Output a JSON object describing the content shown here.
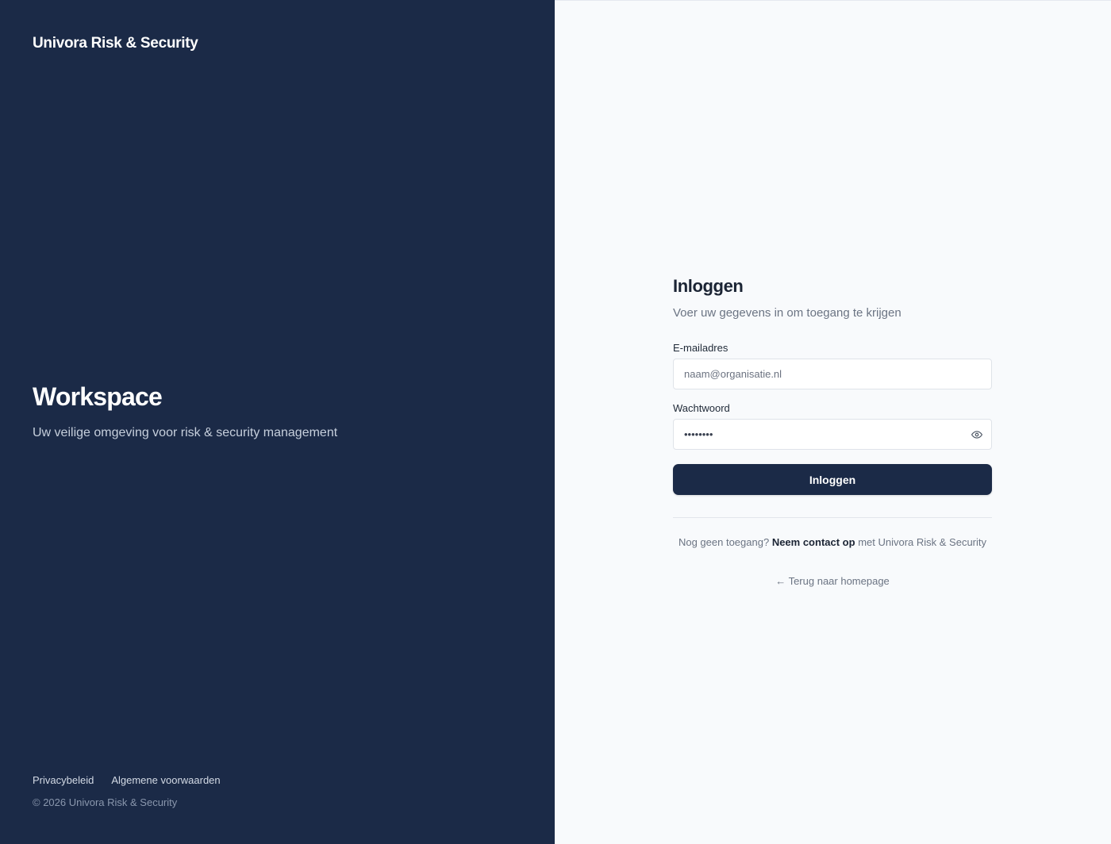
{
  "left": {
    "brand": "Univora Risk & Security",
    "hero_title": "Workspace",
    "hero_subtitle": "Uw veilige omgeving voor risk & security management",
    "footer_links": [
      "Privacybeleid",
      "Algemene voorwaarden"
    ],
    "copyright": "© 2026 Univora Risk & Security"
  },
  "form": {
    "title": "Inloggen",
    "subtitle": "Voer uw gegevens in om toegang te krijgen",
    "email_label": "E-mailadres",
    "email_placeholder": "naam@organisatie.nl",
    "password_label": "Wachtwoord",
    "password_value": "••••••••",
    "submit_label": "Inloggen",
    "contact_prefix": "Nog geen toegang?",
    "contact_link": "Neem contact op",
    "contact_suffix": "met Univora Risk & Security",
    "back_link": "← Terug naar homepage",
    "password_toggle_icon": "eye-icon"
  },
  "colors": {
    "panel_navy": "#1b2a47",
    "right_background": "#f8fafc",
    "button_background": "#1b2a47"
  }
}
